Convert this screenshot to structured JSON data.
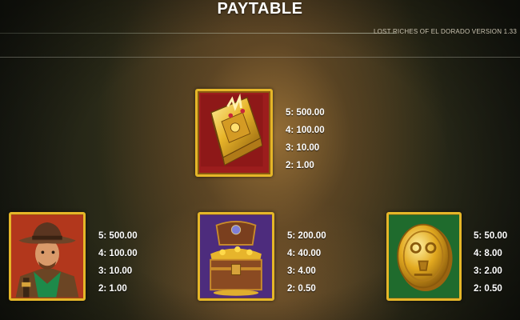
{
  "title": "PAYTABLE",
  "version": "LOST RICHES OF EL DORADO VERSION 1.33",
  "symbols": [
    {
      "name": "golden-book",
      "bg": "#9c1d1d",
      "pays": [
        "5: 500.00",
        "4: 100.00",
        "3: 10.00",
        "2: 1.00"
      ]
    },
    {
      "name": "explorer",
      "bg": "#b2371c",
      "pays": [
        "5: 500.00",
        "4: 100.00",
        "3: 10.00",
        "2: 1.00"
      ]
    },
    {
      "name": "treasure-chest",
      "bg": "#4d2c7d",
      "pays": [
        "5: 200.00",
        "4: 40.00",
        "3: 4.00",
        "2: 0.50"
      ]
    },
    {
      "name": "gold-coin",
      "bg": "#1f6b2d",
      "pays": [
        "5: 50.00",
        "4: 8.00",
        "3: 2.00",
        "2: 0.50"
      ]
    }
  ]
}
